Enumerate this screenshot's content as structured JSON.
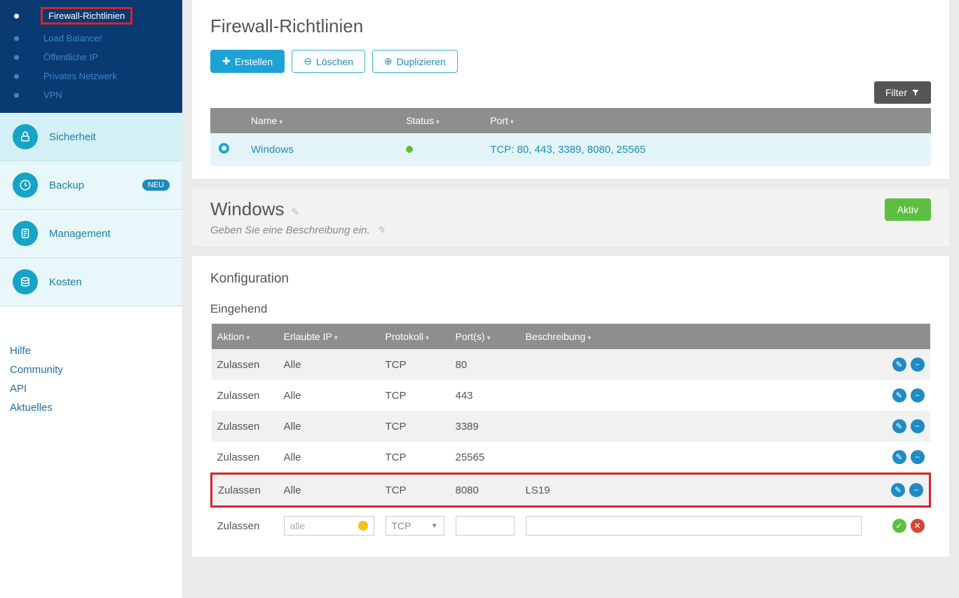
{
  "sidebar": {
    "net_items": [
      {
        "label": "Firewall-Richtlinien",
        "active": true
      },
      {
        "label": "Load Balancer"
      },
      {
        "label": "Öffentliche IP"
      },
      {
        "label": "Privates Netzwerk"
      },
      {
        "label": "VPN"
      }
    ],
    "menu": [
      {
        "label": "Sicherheit",
        "icon": "lock"
      },
      {
        "label": "Backup",
        "icon": "history",
        "badge": "NEU"
      },
      {
        "label": "Management",
        "icon": "clipboard"
      },
      {
        "label": "Kosten",
        "icon": "coins"
      }
    ],
    "links": [
      "Hilfe",
      "Community",
      "API",
      "Aktuelles"
    ]
  },
  "page": {
    "title": "Firewall-Richtlinien",
    "actions": {
      "create": "Erstellen",
      "delete": "Löschen",
      "duplicate": "Duplizieren"
    },
    "filter_label": "Filter"
  },
  "policies": {
    "headers": {
      "name": "Name",
      "status": "Status",
      "port": "Port"
    },
    "rows": [
      {
        "name": "Windows",
        "ports": "TCP: 80, 443, 3389, 8080, 25565"
      }
    ]
  },
  "detail": {
    "title": "Windows",
    "desc": "Geben Sie eine Beschreibung ein.",
    "active_label": "Aktiv"
  },
  "config": {
    "title": "Konfiguration",
    "sub": "Eingehend",
    "headers": {
      "action": "Aktion",
      "allowed": "Erlaubte IP",
      "proto": "Protokoll",
      "ports": "Port(s)",
      "desc": "Beschreibung"
    },
    "rows": [
      {
        "action": "Zulassen",
        "allowed": "Alle",
        "proto": "TCP",
        "ports": "80",
        "desc": ""
      },
      {
        "action": "Zulassen",
        "allowed": "Alle",
        "proto": "TCP",
        "ports": "443",
        "desc": ""
      },
      {
        "action": "Zulassen",
        "allowed": "Alle",
        "proto": "TCP",
        "ports": "3389",
        "desc": ""
      },
      {
        "action": "Zulassen",
        "allowed": "Alle",
        "proto": "TCP",
        "ports": "25565",
        "desc": ""
      },
      {
        "action": "Zulassen",
        "allowed": "Alle",
        "proto": "TCP",
        "ports": "8080",
        "desc": "LS19",
        "hl": true
      }
    ],
    "newrow": {
      "action": "Zulassen",
      "allowed_placeholder": "alle",
      "proto_value": "TCP"
    }
  }
}
